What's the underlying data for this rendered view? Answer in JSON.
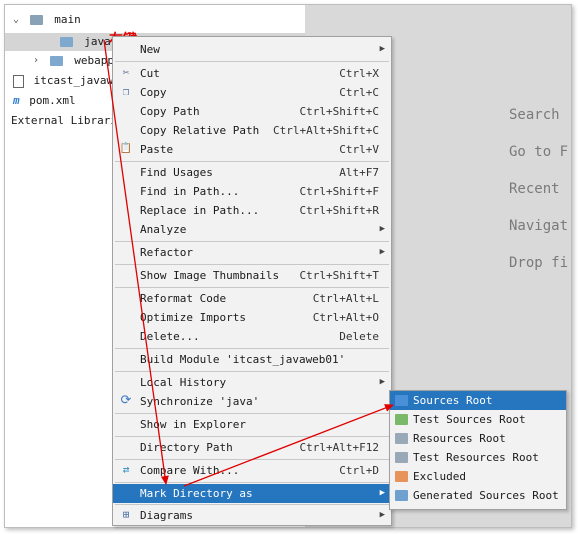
{
  "tree": {
    "items": [
      {
        "label": "main",
        "icon": "folder-icon"
      },
      {
        "label": "java",
        "icon": "folder-icon"
      },
      {
        "label": "webapp",
        "icon": "web-folder-icon"
      },
      {
        "label": "itcast_javaweb",
        "icon": "module-file-icon"
      },
      {
        "label": "pom.xml",
        "icon": "maven-icon",
        "icon_glyph": "m"
      },
      {
        "label": "External Libraries"
      }
    ]
  },
  "annotation": {
    "text": "右键",
    "color": "#e00000"
  },
  "editor_hints": [
    "Search",
    "Go to F",
    "Recent",
    "Navigat",
    "Drop fi"
  ],
  "context_menu": {
    "items": [
      {
        "label": "New",
        "shortcut": "",
        "submenu": true
      },
      {
        "label": "Cut",
        "shortcut": "Ctrl+X",
        "icon": "scissors-icon",
        "glyph": "✂"
      },
      {
        "label": "Copy",
        "shortcut": "Ctrl+C",
        "icon": "copy-icon",
        "glyph": "❐"
      },
      {
        "label": "Copy Path",
        "shortcut": "Ctrl+Shift+C"
      },
      {
        "label": "Copy Relative Path",
        "shortcut": "Ctrl+Alt+Shift+C"
      },
      {
        "label": "Paste",
        "shortcut": "Ctrl+V",
        "icon": "paste-icon",
        "glyph": "📋"
      },
      {
        "label": "Find Usages",
        "shortcut": "Alt+F7"
      },
      {
        "label": "Find in Path...",
        "shortcut": "Ctrl+Shift+F"
      },
      {
        "label": "Replace in Path...",
        "shortcut": "Ctrl+Shift+R"
      },
      {
        "label": "Analyze",
        "shortcut": "",
        "submenu": true
      },
      {
        "label": "Refactor",
        "shortcut": "",
        "submenu": true
      },
      {
        "label": "Show Image Thumbnails",
        "shortcut": "Ctrl+Shift+T"
      },
      {
        "label": "Reformat Code",
        "shortcut": "Ctrl+Alt+L"
      },
      {
        "label": "Optimize Imports",
        "shortcut": "Ctrl+Alt+O"
      },
      {
        "label": "Delete...",
        "shortcut": "Delete"
      },
      {
        "label": "Build Module 'itcast_javaweb01'",
        "shortcut": ""
      },
      {
        "label": "Local History",
        "shortcut": "",
        "submenu": true
      },
      {
        "label": "Synchronize 'java'",
        "shortcut": "",
        "icon": "sync-icon",
        "glyph": "⟳"
      },
      {
        "label": "Show in Explorer",
        "shortcut": ""
      },
      {
        "label": "Directory Path",
        "shortcut": "Ctrl+Alt+F12"
      },
      {
        "label": "Compare With...",
        "shortcut": "Ctrl+D",
        "icon": "compare-icon",
        "glyph": "⇄"
      },
      {
        "label": "Mark Directory as",
        "shortcut": "",
        "submenu": true,
        "highlighted": true
      },
      {
        "label": "Diagrams",
        "shortcut": "",
        "submenu": true,
        "icon": "diagram-icon",
        "glyph": "⊞"
      }
    ]
  },
  "submenu": {
    "items": [
      {
        "label": "Sources Root",
        "color": "#4a90d9",
        "highlighted": true
      },
      {
        "label": "Test Sources Root",
        "color": "#7ab86a"
      },
      {
        "label": "Resources Root",
        "color": "#9aa9b8"
      },
      {
        "label": "Test Resources Root",
        "color": "#9aa9b8"
      },
      {
        "label": "Excluded",
        "color": "#e8935a"
      },
      {
        "label": "Generated Sources Root",
        "color": "#6fa0cf"
      }
    ]
  },
  "colors": {
    "selection": "#2675bf",
    "arrow": "#e00000",
    "editor_bg": "#d9d9d9"
  }
}
